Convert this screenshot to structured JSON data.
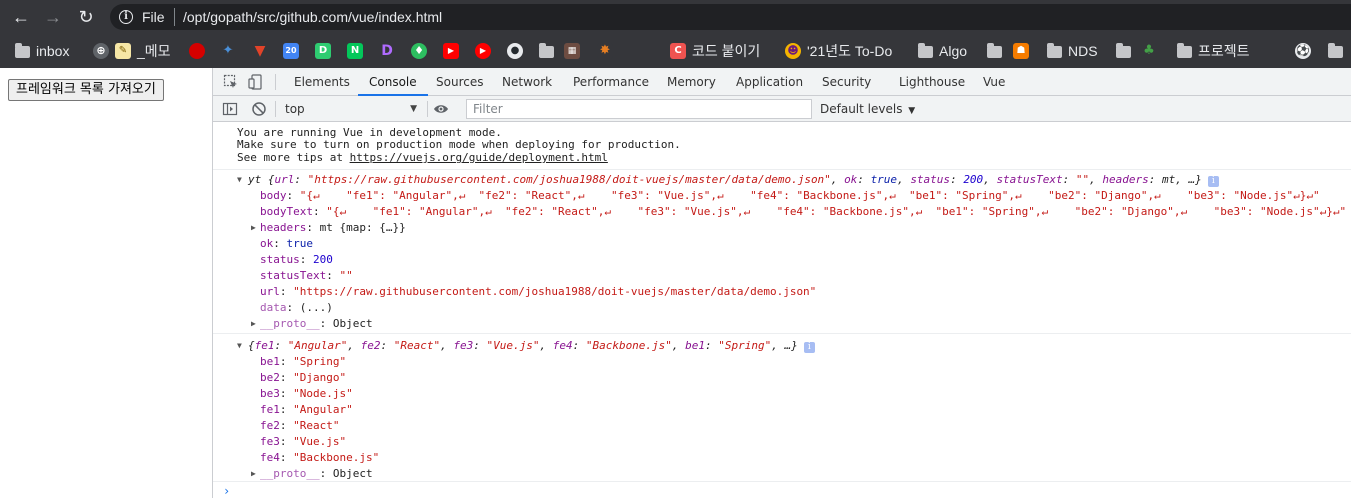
{
  "browser": {
    "omnibox": {
      "scheme": "File",
      "url": "/opt/gopath/src/github.com/vue/index.html"
    },
    "bookmarks": [
      {
        "label": "inbox",
        "icon": "folder-icon"
      },
      {
        "label": "_메모",
        "icon": "memo-icon"
      },
      {
        "label": "코드 붙이기",
        "icon": "c-icon"
      },
      {
        "label": "'21년도 To-Do",
        "icon": "devil-icon"
      },
      {
        "label": "Algo",
        "icon": "folder-icon"
      },
      {
        "label": "NDS",
        "icon": "folder-icon"
      },
      {
        "label": "프로젝트",
        "icon": "folder-icon"
      }
    ]
  },
  "page": {
    "button_label": "프레임워크 목록 가져오기"
  },
  "devtools": {
    "tabs": [
      "Elements",
      "Console",
      "Sources",
      "Network",
      "Performance",
      "Memory",
      "Application",
      "Security",
      "Lighthouse",
      "Vue"
    ],
    "active_tab": "Console",
    "toolbar": {
      "context": "top",
      "filter_placeholder": "Filter",
      "levels": "Default levels"
    }
  },
  "console": {
    "vue_notice": [
      "You are running Vue in development mode.",
      "Make sure to turn on production mode when deploying for production.",
      "See more tips at "
    ],
    "vue_notice_link": "https://vuejs.org/guide/deployment.html",
    "response": {
      "summary_prefix": "yt {",
      "summary": [
        {
          "k": "url",
          "v": "\"https://raw.githubusercontent.com/joshua1988/doit-vuejs/master/data/demo.json\"",
          "t": "s"
        },
        {
          "k": "ok",
          "v": "true",
          "t": "kw"
        },
        {
          "k": "status",
          "v": "200",
          "t": "n"
        },
        {
          "k": "statusText",
          "v": "\"\"",
          "t": "s"
        },
        {
          "k": "headers",
          "v": "mt",
          "t": "p"
        }
      ],
      "summary_suffix": ", …}",
      "body_key": "body",
      "body_val": "\"{↵    \"fe1\": \"Angular\",↵  \"fe2\": \"React\",↵    \"fe3\": \"Vue.js\",↵    \"fe4\": \"Backbone.js\",↵  \"be1\": \"Spring\",↵    \"be2\": \"Django\",↵    \"be3\": \"Node.js\"↵}↵\"",
      "bodytext_key": "bodyText",
      "bodytext_val": "\"{↵    \"fe1\": \"Angular\",↵  \"fe2\": \"React\",↵    \"fe3\": \"Vue.js\",↵    \"fe4\": \"Backbone.js\",↵  \"be1\": \"Spring\",↵    \"be2\": \"Django\",↵    \"be3\": \"Node.js\"↵}↵\"",
      "headers_key": "headers",
      "headers_val": "mt {map: {…}}",
      "ok_key": "ok",
      "ok_val": "true",
      "status_key": "status",
      "status_val": "200",
      "statustext_key": "statusText",
      "statustext_val": "\"\"",
      "url_key": "url",
      "url_val": "\"https://raw.githubusercontent.com/joshua1988/doit-vuejs/master/data/demo.json\"",
      "data_key": "data",
      "data_val": "(...)",
      "proto_key": "__proto__",
      "proto_val": "Object"
    },
    "object": {
      "summary_prefix": "{",
      "summary": [
        {
          "k": "fe1",
          "v": "\"Angular\""
        },
        {
          "k": "fe2",
          "v": "\"React\""
        },
        {
          "k": "fe3",
          "v": "\"Vue.js\""
        },
        {
          "k": "fe4",
          "v": "\"Backbone.js\""
        },
        {
          "k": "be1",
          "v": "\"Spring\""
        }
      ],
      "summary_suffix": ", …}",
      "props": [
        {
          "k": "be1",
          "v": "\"Spring\""
        },
        {
          "k": "be2",
          "v": "\"Django\""
        },
        {
          "k": "be3",
          "v": "\"Node.js\""
        },
        {
          "k": "fe1",
          "v": "\"Angular\""
        },
        {
          "k": "fe2",
          "v": "\"React\""
        },
        {
          "k": "fe3",
          "v": "\"Vue.js\""
        },
        {
          "k": "fe4",
          "v": "\"Backbone.js\""
        }
      ],
      "proto_key": "__proto__",
      "proto_val": "Object"
    },
    "prompt": "›"
  }
}
